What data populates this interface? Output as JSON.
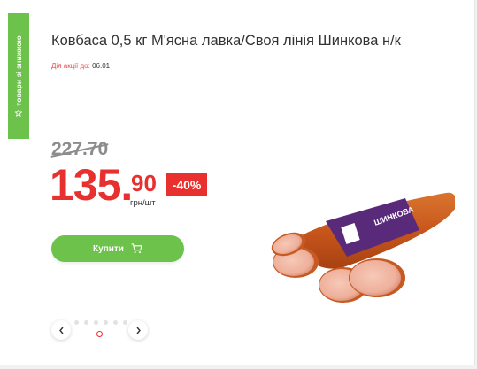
{
  "side_tab": {
    "label": "товари зі знижкою"
  },
  "product": {
    "title": "Ковбаса 0,5 кг М'ясна лавка/Своя лінія Шинкова н/к",
    "promo_label": "Дія акції до:",
    "promo_date": "06.01",
    "old_price": "227.70",
    "price_main": "135.",
    "price_cents": "90",
    "discount": "-40%",
    "unit": "грн/шт",
    "package_text": "ШИНКОВА"
  },
  "buy_button": {
    "label": "Купити",
    "icon": "cart-icon"
  },
  "carousel": {
    "dot_count": 7,
    "active_index": 4
  },
  "colors": {
    "accent_green": "#6cc24a",
    "price_red": "#e8302f",
    "old_price_gray": "#8c8c8c"
  }
}
